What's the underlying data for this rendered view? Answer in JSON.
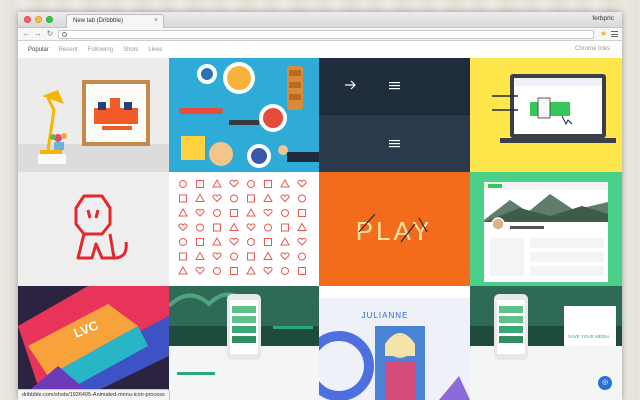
{
  "window": {
    "tab_title": "New tab (Dribbble)",
    "profile_name": "ferbprlc",
    "address_value": "",
    "status_url": "dribbble.com/shots/1926405-Animated-menu-icon-process"
  },
  "nav": {
    "items": [
      "Popular",
      "Recent",
      "Following",
      "Shots",
      "Likes"
    ],
    "active_index": 0,
    "chrome_links": "Chrome links"
  },
  "shots": {
    "play_text": "PLAY",
    "lvc_text": "LVC",
    "julianne_text": "JULIANNE",
    "save_text": "SAVE YOUR MEDIA",
    "icons": [
      "search-icon",
      "gear-icon",
      "close-icon",
      "dribbble-icon"
    ]
  },
  "colors": {
    "yellow": "#ffe64a",
    "orange": "#f46b1c",
    "navy": "#1d2b3c",
    "teal": "#20b7b0",
    "blue": "#36a6d9"
  }
}
